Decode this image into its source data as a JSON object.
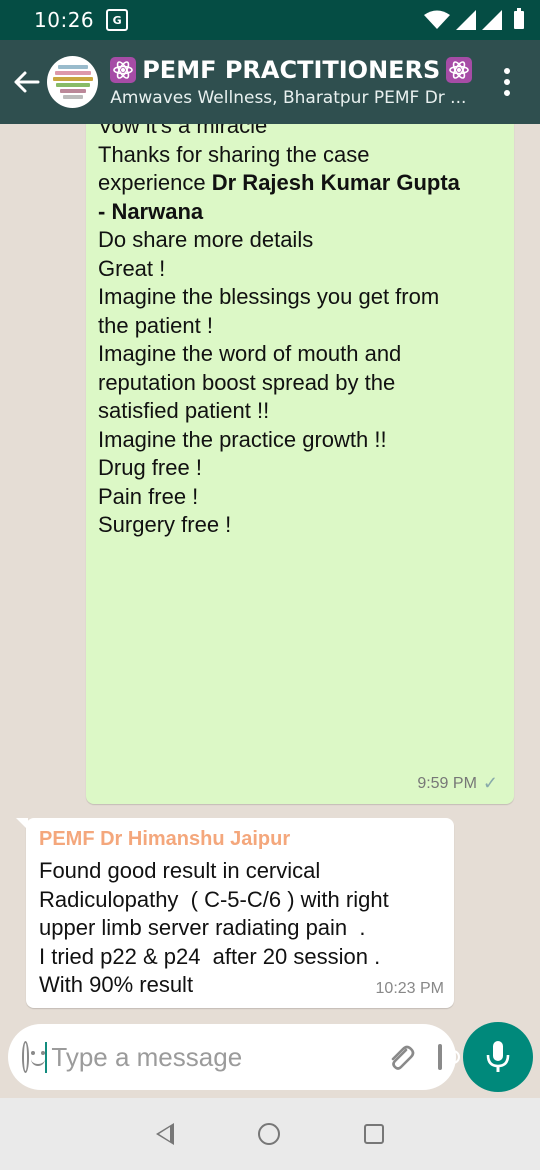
{
  "status_bar": {
    "time": "10:26",
    "translate_glyph": "G"
  },
  "header": {
    "title": "PEMF PRACTITIONERS",
    "subtitle": "Amwaves Wellness, Bharatpur PEMF Dr ..."
  },
  "messages": {
    "outgoing": {
      "lines": [
        "Vow it's a miracle",
        "",
        "Thanks for sharing the case",
        "experience ",
        "- Narwana",
        "",
        "Do share more details",
        "",
        "Great !",
        "",
        "Imagine the blessings you get from",
        "the patient !",
        "",
        "Imagine the word of mouth and",
        "reputation boost spread by the",
        "satisfied patient !!",
        "",
        "Imagine the practice growth !!",
        "",
        "Drug free !",
        "",
        "Pain free !",
        "",
        "Surgery free !"
      ],
      "bold_name": "Dr Rajesh Kumar Gupta",
      "time": "9:59 PM",
      "status_tick": "✓"
    },
    "incoming": {
      "sender": "PEMF Dr Himanshu Jaipur",
      "lines": [
        "Found good result in cervical",
        "Radiculopathy  ( C-5-C/6 ) with right",
        "upper limb server radiating pain  .",
        "I tried p22 & p24  after 20 session .",
        "With 90% result"
      ],
      "time": "10:23 PM"
    }
  },
  "composer": {
    "placeholder": "Type a message"
  },
  "icons": {
    "back": "arrow-left-icon",
    "menu": "more-vertical-icon",
    "emoji": "emoji-icon",
    "attach": "paperclip-icon",
    "camera": "camera-icon",
    "mic": "mic-icon"
  },
  "colors": {
    "header_bg": "#2f4f4f",
    "status_bg": "#054d44",
    "outgoing_bubble": "#dcf8c6",
    "incoming_bubble": "#ffffff",
    "sender_name": "#f4a77c",
    "accent": "#00897b"
  }
}
